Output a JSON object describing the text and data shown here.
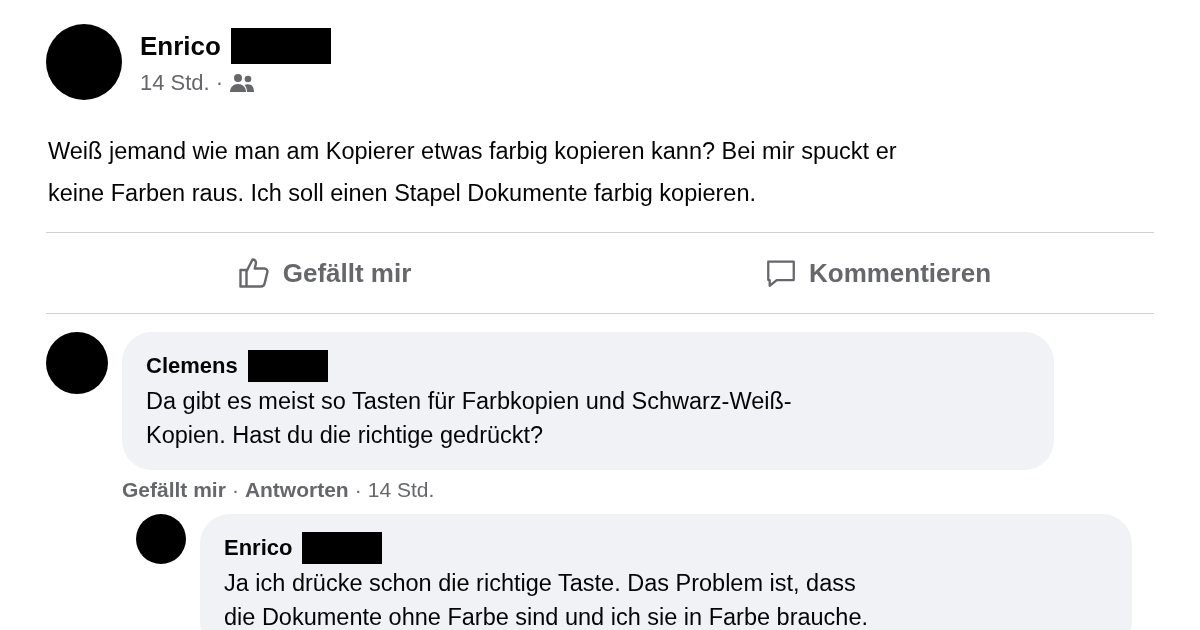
{
  "post": {
    "author": "Enrico",
    "redacted": true,
    "time": "14 Std.",
    "separator": "·",
    "text": "Weiß jemand wie man am Kopierer etwas farbig kopieren kann? Bei mir spuckt er\nkeine Farben raus. Ich soll einen Stapel Dokumente farbig kopieren."
  },
  "actions": [
    {
      "kind": "like",
      "label": "Gefällt mir"
    },
    {
      "kind": "comment",
      "label": "Kommentieren"
    }
  ],
  "comments": [
    {
      "author": "Clemens",
      "redacted": true,
      "text": "Da gibt es meist so Tasten für Farbkopien und Schwarz-Weiß-\nKopien. Hast du die richtige gedrückt?",
      "meta": [
        {
          "kind": "link",
          "label": "Gefällt mir"
        },
        {
          "kind": "sep",
          "label": "·"
        },
        {
          "kind": "link",
          "label": "Antworten"
        },
        {
          "kind": "sep",
          "label": "·"
        },
        {
          "kind": "time",
          "label": "14 Std."
        }
      ],
      "replies": [
        {
          "author": "Enrico",
          "redacted": true,
          "text": "Ja ich drücke schon die richtige Taste. Das Problem ist, dass\ndie Dokumente ohne Farbe sind und ich sie in Farbe brauche."
        }
      ]
    }
  ]
}
